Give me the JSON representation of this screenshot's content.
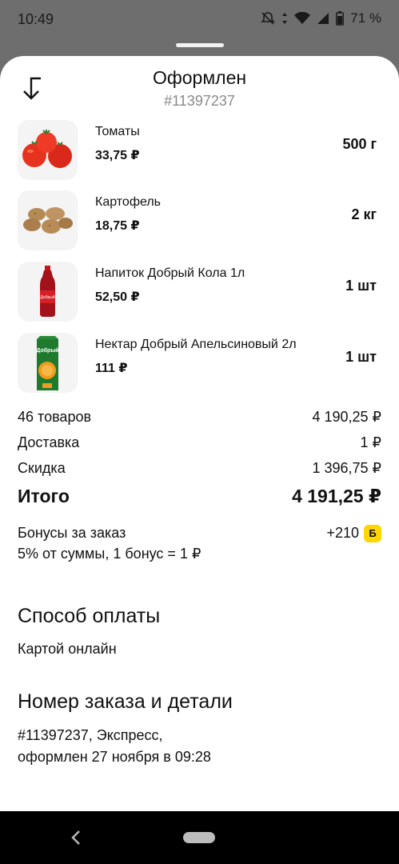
{
  "status": {
    "time": "10:49",
    "battery": "71 %"
  },
  "header": {
    "title": "Оформлен",
    "order_number": "#11397237"
  },
  "items": [
    {
      "name": "Томаты",
      "price": "33,75 ₽",
      "qty": "500 г",
      "icon": "tomato-icon"
    },
    {
      "name": "Картофель",
      "price": "18,75 ₽",
      "qty": "2 кг",
      "icon": "potato-icon"
    },
    {
      "name": "Напиток Добрый Кола 1л",
      "price": "52,50 ₽",
      "qty": "1 шт",
      "icon": "cola-bottle-icon"
    },
    {
      "name": "Нектар Добрый Апельсиновый 2л",
      "price": "111 ₽",
      "qty": "1 шт",
      "icon": "juice-carton-icon"
    }
  ],
  "summary": {
    "goods_label": "46 товаров",
    "goods_value": "4 190,25 ₽",
    "delivery_label": "Доставка",
    "delivery_value": "1 ₽",
    "discount_label": "Скидка",
    "discount_value": "1 396,75 ₽",
    "total_label": "Итого",
    "total_value": "4 191,25 ₽",
    "bonus_label": "Бонусы за заказ",
    "bonus_value": "+210",
    "bonus_badge": "Б",
    "bonus_note": "5% от суммы, 1 бонус = 1 ₽"
  },
  "payment": {
    "title": "Способ оплаты",
    "method": "Картой онлайн"
  },
  "details": {
    "title": "Номер заказа и детали",
    "line1": "#11397237, Экспресс,",
    "line2": "оформлен 27 ноября в 09:28"
  },
  "colors": {
    "bonus_badge": "#ffd600",
    "muted": "#8a8a8a"
  }
}
